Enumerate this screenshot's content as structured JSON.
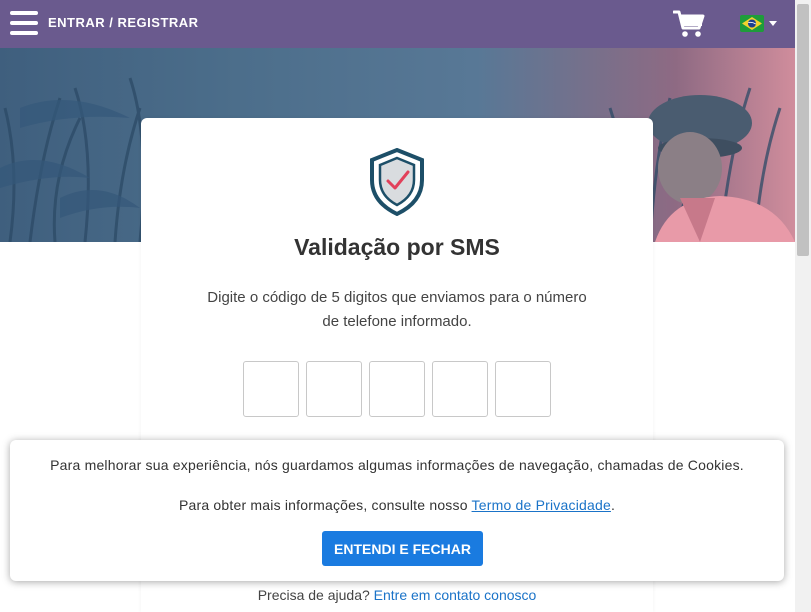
{
  "header": {
    "login_label": "ENTRAR / REGISTRAR",
    "menu_icon": "hamburger-menu-icon",
    "cart_icon": "shopping-cart-icon",
    "language_icon": "brazil-flag-icon",
    "background_color": "#6a5a8e"
  },
  "card": {
    "icon": "shield-check-icon",
    "title": "Validação por SMS",
    "description": "Digite o código de 5 digitos que enviamos para o número de telefone informado.",
    "code_inputs": [
      "",
      "",
      "",
      "",
      ""
    ],
    "help_text": "Precisa de ajuda?",
    "help_link": "Entre em contato conosco"
  },
  "cookie_banner": {
    "line1": "Para melhorar sua experiência, nós guardamos algumas informações de navegação, chamadas de Cookies.",
    "line2_prefix": "Para obter mais informações, consulte nosso",
    "privacy_link": "Termo de Privacidade",
    "line2_suffix": ".",
    "accept_button": "ENTENDI E FECHAR",
    "button_color": "#1a7be0"
  },
  "colors": {
    "link": "#1a73c8",
    "shield_outline": "#1d4f68",
    "check_mark": "#e2405a"
  }
}
